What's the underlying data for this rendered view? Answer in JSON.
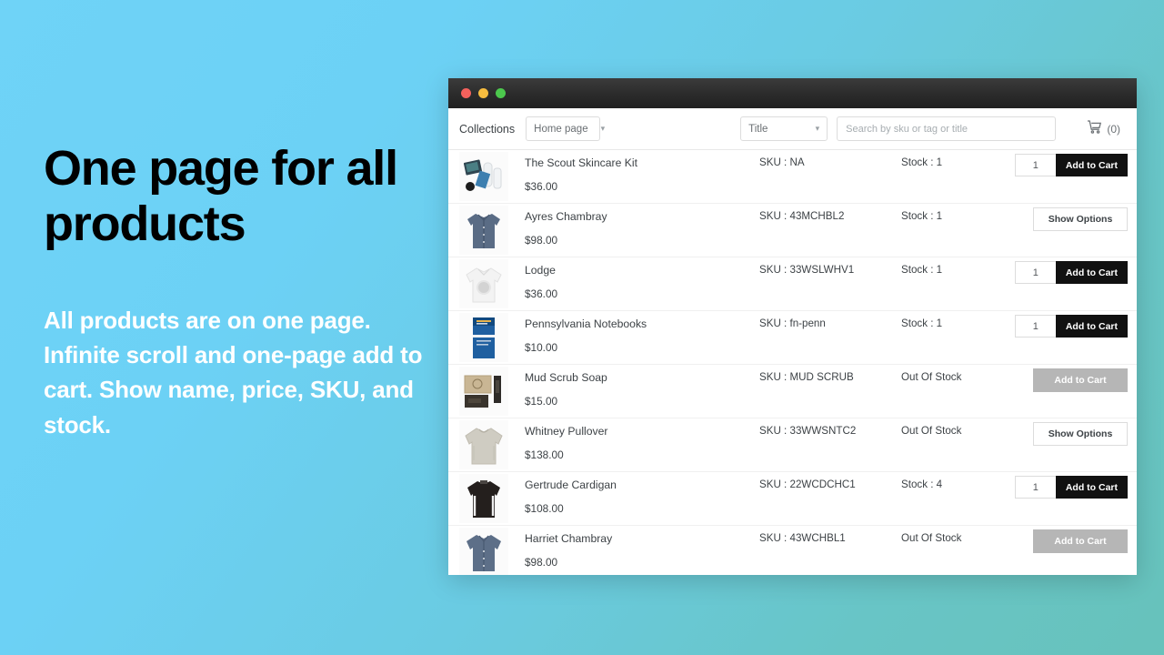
{
  "promo": {
    "headline": "One page for all products",
    "body": "All products are on one page. Infinite scroll and one-page add to cart. Show name, price, SKU, and stock."
  },
  "colors": {
    "background_start": "#6FD3F7",
    "background_end": "#67C2BB",
    "primary_button": "#111111",
    "disabled_button": "#b6b6b6",
    "text": "#3d4246"
  },
  "window": {
    "traffic_lights": [
      "close-red",
      "minimize-yellow",
      "maximize-green"
    ]
  },
  "toolbar": {
    "collections_label": "Collections",
    "collection_value": "Home page",
    "sort_value": "Title",
    "search_placeholder": "Search by sku or tag or title",
    "cart_icon": "shopping-cart-icon",
    "cart_count": "(0)"
  },
  "labels": {
    "add_to_cart": "Add to Cart",
    "show_options": "Show Options",
    "qty_value": "1"
  },
  "products": [
    {
      "name": "The Scout Skincare Kit",
      "price": "$36.00",
      "sku": "SKU : NA",
      "stock": "Stock : 1",
      "action": "add",
      "thumb": "skincare-kit-thumbnail"
    },
    {
      "name": "Ayres Chambray",
      "price": "$98.00",
      "sku": "SKU : 43MCHBL2",
      "stock": "Stock : 1",
      "action": "options",
      "thumb": "chambray-shirt-thumbnail"
    },
    {
      "name": "Lodge",
      "price": "$36.00",
      "sku": "SKU : 33WSLWHV1",
      "stock": "Stock : 1",
      "action": "add",
      "thumb": "white-tshirt-thumbnail"
    },
    {
      "name": "Pennsylvania Notebooks",
      "price": "$10.00",
      "sku": "SKU : fn-penn",
      "stock": "Stock : 1",
      "action": "add",
      "thumb": "notebook-thumbnail"
    },
    {
      "name": "Mud Scrub Soap",
      "price": "$15.00",
      "sku": "SKU : MUD SCRUB",
      "stock": "Out Of Stock",
      "action": "disabled",
      "thumb": "soap-box-thumbnail"
    },
    {
      "name": "Whitney Pullover",
      "price": "$138.00",
      "sku": "SKU : 33WWSNTC2",
      "stock": "Out Of Stock",
      "action": "options",
      "thumb": "pullover-sweater-thumbnail"
    },
    {
      "name": "Gertrude Cardigan",
      "price": "$108.00",
      "sku": "SKU : 22WCDCHC1",
      "stock": "Stock : 4",
      "action": "add",
      "thumb": "dark-cardigan-thumbnail"
    },
    {
      "name": "Harriet Chambray",
      "price": "$98.00",
      "sku": "SKU : 43WCHBL1",
      "stock": "Out Of Stock",
      "action": "disabled",
      "thumb": "blue-chambray-thumbnail"
    }
  ]
}
